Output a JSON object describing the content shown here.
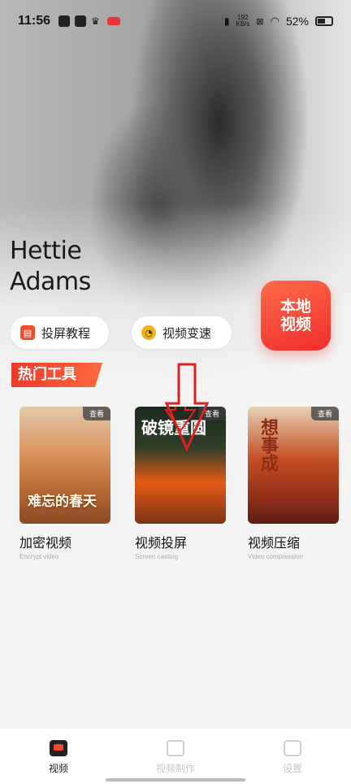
{
  "status_bar": {
    "time": "11:56",
    "net_speed": "192\nKB/s",
    "battery": "52%"
  },
  "hero": {
    "title_line1": "Hettie",
    "title_line2": "Adams",
    "local_video_label": "本地\n视频"
  },
  "quick_actions": [
    {
      "label": "投屏教程",
      "icon": "book-icon",
      "color": "#f04d2a"
    },
    {
      "label": "视频变速",
      "icon": "speed-icon",
      "color": "#f2b21d"
    }
  ],
  "section": {
    "title": "热门工具"
  },
  "tools": [
    {
      "title": "加密视频",
      "subtitle": "Encrypt video",
      "view_label": "查看",
      "overlay": "难忘的春天"
    },
    {
      "title": "视频投屏",
      "subtitle": "Screen casting",
      "view_label": "查看",
      "overlay": "破镜重圆"
    },
    {
      "title": "视频压缩",
      "subtitle": "Video compression",
      "view_label": "查看",
      "overlay": "想事成"
    }
  ],
  "bottom_nav": [
    {
      "label": "视频",
      "icon": "video-tab-icon",
      "active": true
    },
    {
      "label": "视频制作",
      "icon": "film-icon",
      "active": false
    },
    {
      "label": "设置",
      "icon": "settings-icon",
      "active": false
    }
  ],
  "colors": {
    "accent": "#f04d2a",
    "accent_dark": "#ee3a2a",
    "inactive": "#c8c8c8"
  }
}
